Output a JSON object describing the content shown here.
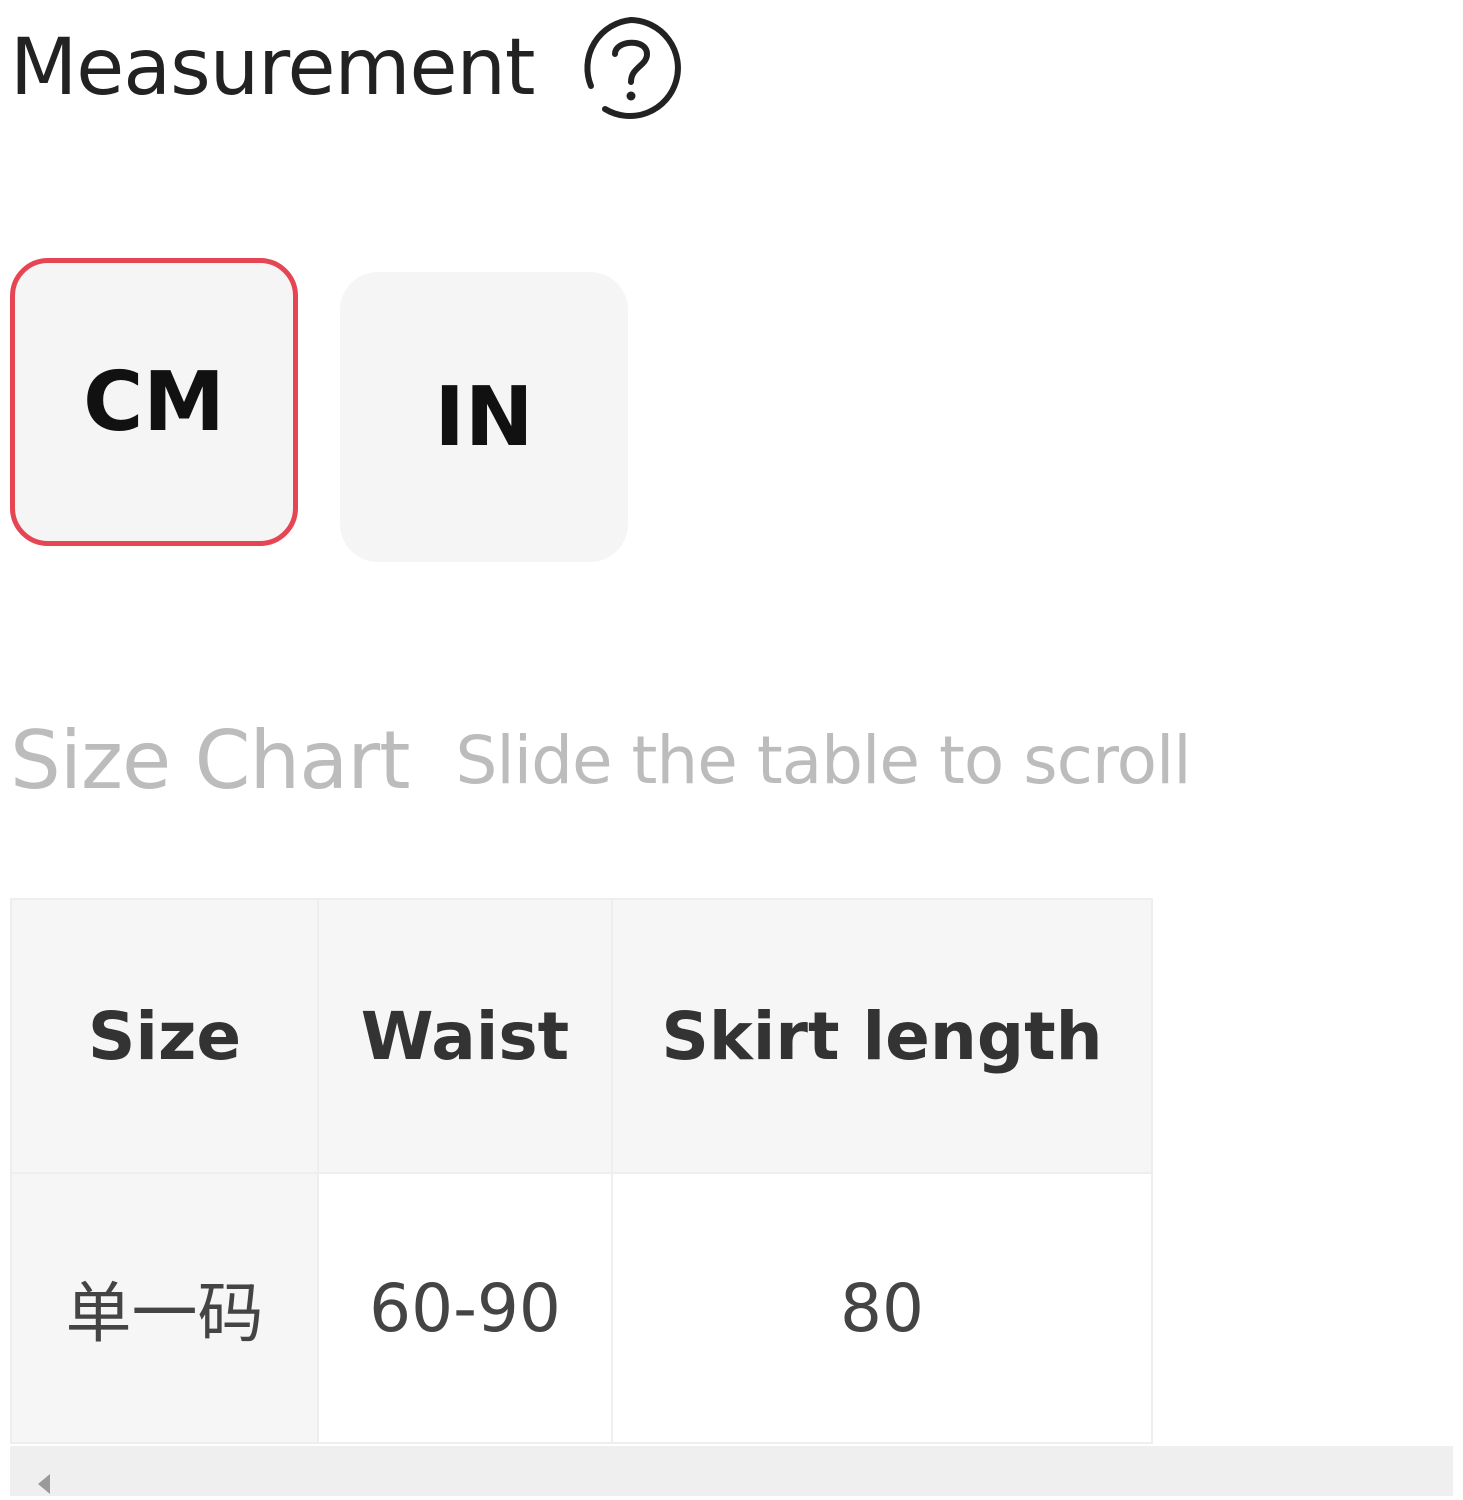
{
  "measurement": {
    "title": "Measurement",
    "help_icon": "question-circle-icon"
  },
  "units": {
    "options": [
      "CM",
      "IN"
    ],
    "selected": "CM",
    "accent_color": "#e64553"
  },
  "size_chart": {
    "title": "Size Chart",
    "hint": "Slide the table to scroll",
    "headers": [
      "Size",
      "Waist",
      "Skirt length"
    ],
    "rows": [
      [
        "单一码",
        "60-90",
        "80"
      ]
    ]
  },
  "scrollbar": {
    "icon": "scroll-left-arrow-icon"
  }
}
